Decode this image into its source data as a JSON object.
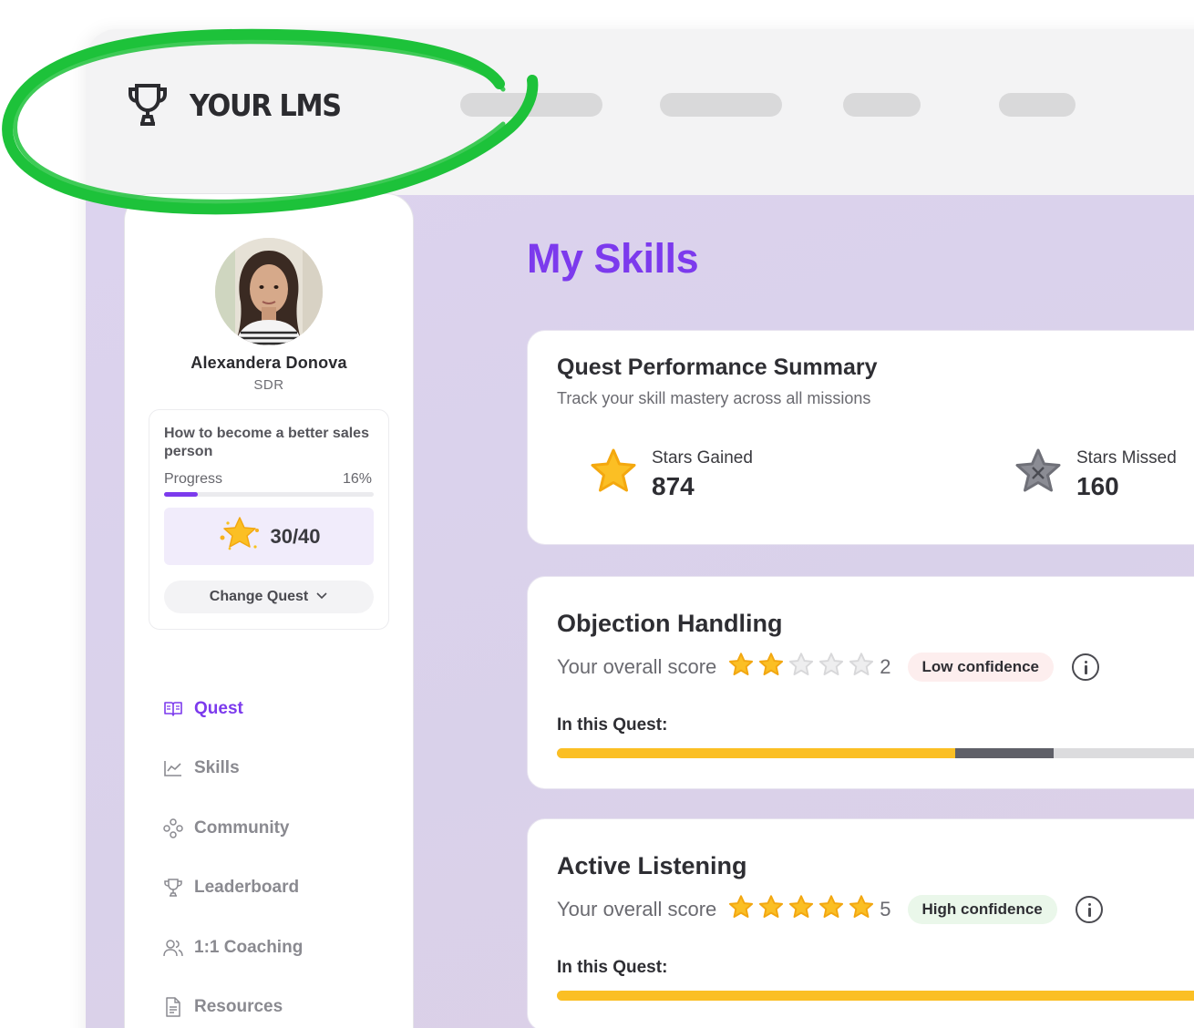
{
  "app": {
    "logo_text": "YOUR LMS"
  },
  "sidebar": {
    "user": {
      "name": "Alexandera Donova",
      "role": "SDR"
    },
    "quest": {
      "title": "How to become a better sales person",
      "progress_label": "Progress",
      "progress_value": "16%",
      "progress_fraction": 0.16,
      "stars_text": "30/40",
      "change_label": "Change Quest"
    },
    "menu": [
      {
        "label": "Quest",
        "icon": "book-icon",
        "active": true
      },
      {
        "label": "Skills",
        "icon": "chart-line-icon",
        "active": false
      },
      {
        "label": "Community",
        "icon": "community-icon",
        "active": false
      },
      {
        "label": "Leaderboard",
        "icon": "trophy-icon",
        "active": false
      },
      {
        "label": "1:1 Coaching",
        "icon": "users-icon",
        "active": false
      },
      {
        "label": "Resources",
        "icon": "document-icon",
        "active": false
      }
    ]
  },
  "main": {
    "title": "My Skills",
    "summary": {
      "title": "Quest Performance Summary",
      "subtitle": "Track your skill mastery across all missions",
      "stars_gained_label": "Stars Gained",
      "stars_gained_value": "874",
      "stars_missed_label": "Stars Missed",
      "stars_missed_value": "160"
    },
    "skills": [
      {
        "title": "Objection Handling",
        "score_label": "Your overall score",
        "score": "2",
        "rating": 2,
        "confidence": "Low confidence",
        "in_quest_label": "In this Quest:",
        "bar_gained_fraction": 0.59,
        "bar_missed_fraction": 0.147
      },
      {
        "title": "Active Listening",
        "score_label": "Your overall score",
        "score": "5",
        "rating": 5,
        "confidence": "High confidence",
        "in_quest_label": "In this Quest:",
        "bar_gained_fraction": 1.0,
        "bar_missed_fraction": 0
      }
    ]
  },
  "colors": {
    "accent": "#7c3aed",
    "star": "#f7c21e",
    "bar_gained": "#fbbf24",
    "bar_missed": "#5f6068",
    "highlight_ring": "#1dc23a"
  }
}
